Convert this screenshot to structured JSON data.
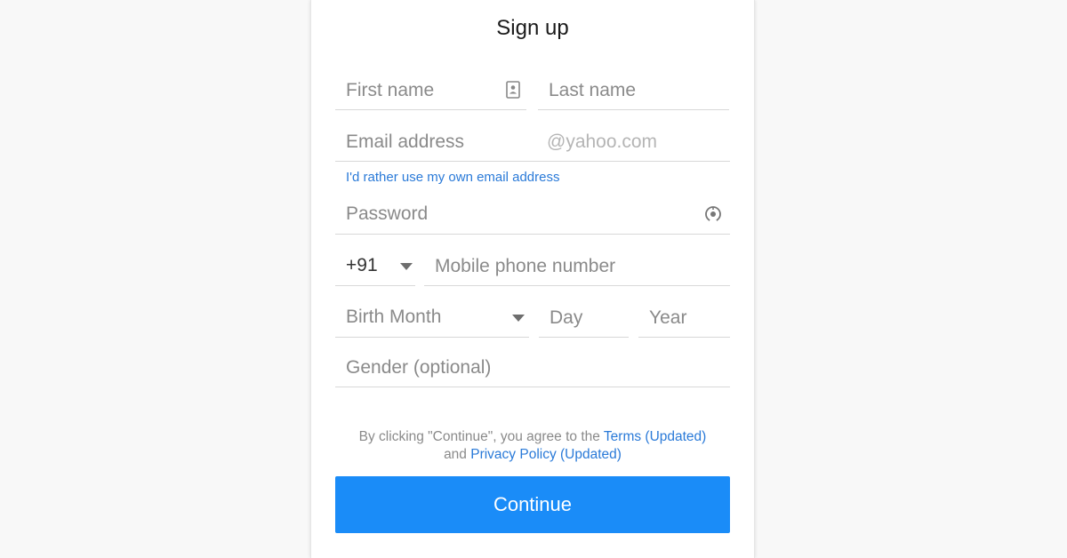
{
  "form": {
    "title": "Sign up",
    "first_name_placeholder": "First name",
    "last_name_placeholder": "Last name",
    "email_placeholder": "Email address",
    "email_suffix": "@yahoo.com",
    "own_email_link": "I'd rather use my own email address",
    "password_placeholder": "Password",
    "country_code": "+91",
    "phone_placeholder": "Mobile phone number",
    "birth_month": "Birth Month",
    "day_placeholder": "Day",
    "year_placeholder": "Year",
    "gender_placeholder": "Gender (optional)"
  },
  "terms": {
    "prefix": "By clicking \"Continue\", you agree to the ",
    "terms_link": "Terms (Updated)",
    "and": "and ",
    "privacy_link": "Privacy Policy (Updated)"
  },
  "continue_label": "Continue",
  "icons": {
    "contact_card": "contact-card-icon",
    "password_toggle": "eye-icon"
  },
  "colors": {
    "accent": "#1a8cf8",
    "link": "#2a7ad8"
  }
}
